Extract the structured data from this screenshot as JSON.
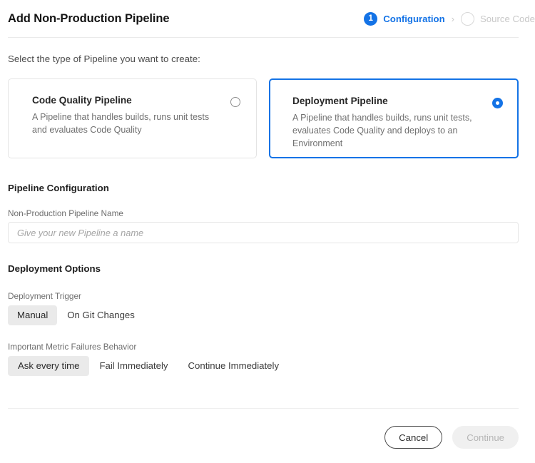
{
  "header": {
    "title": "Add Non-Production Pipeline",
    "stepper": {
      "separator": "›",
      "steps": [
        {
          "number": "1",
          "label": "Configuration",
          "state": "active"
        },
        {
          "number": "",
          "label": "Source Code",
          "state": "inactive"
        }
      ]
    }
  },
  "intro": {
    "text": "Select the type of Pipeline you want to create:"
  },
  "pipeline_types": {
    "options": [
      {
        "title": "Code Quality Pipeline",
        "description": "A Pipeline that handles builds, runs unit tests and evaluates Code Quality",
        "selected": false
      },
      {
        "title": "Deployment Pipeline",
        "description": "A Pipeline that handles builds, runs unit tests, evaluates Code Quality and deploys to an Environment",
        "selected": true
      }
    ]
  },
  "pipeline_configuration": {
    "section_title": "Pipeline Configuration",
    "name_field": {
      "label": "Non-Production Pipeline Name",
      "value": "",
      "placeholder": "Give your new Pipeline a name"
    }
  },
  "deployment_options": {
    "section_title": "Deployment Options",
    "deployment_trigger": {
      "label": "Deployment Trigger",
      "options": [
        "Manual",
        "On Git Changes"
      ],
      "selected": "Manual"
    },
    "metric_failures_behavior": {
      "label": "Important Metric Failures Behavior",
      "options": [
        "Ask every time",
        "Fail Immediately",
        "Continue Immediately"
      ],
      "selected": "Ask every time"
    }
  },
  "footer": {
    "cancel_label": "Cancel",
    "continue_label": "Continue",
    "continue_disabled": true
  },
  "colors": {
    "accent": "#1473e6",
    "text_primary": "#141414",
    "text_secondary": "#707070",
    "selected_pill_bg": "#eaeaea",
    "disabled_button_bg": "#f0f0f0",
    "divider": "#eaeaea"
  }
}
